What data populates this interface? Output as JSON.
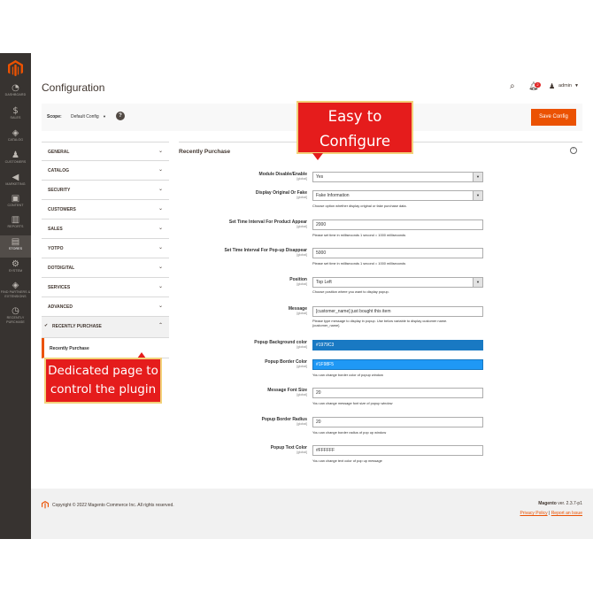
{
  "sidebar": {
    "items": [
      {
        "label": "DASHBOARD",
        "icon": "dashboard-icon"
      },
      {
        "label": "SALES",
        "icon": "dollar-icon"
      },
      {
        "label": "CATALOG",
        "icon": "cube-icon"
      },
      {
        "label": "CUSTOMERS",
        "icon": "person-icon"
      },
      {
        "label": "MARKETING",
        "icon": "megaphone-icon"
      },
      {
        "label": "CONTENT",
        "icon": "content-icon"
      },
      {
        "label": "REPORTS",
        "icon": "bar-chart-icon"
      },
      {
        "label": "STORES",
        "icon": "store-icon"
      },
      {
        "label": "SYSTEM",
        "icon": "gear-icon"
      },
      {
        "label": "FIND PARTNERS & EXTENSIONS",
        "icon": "cubes-icon"
      },
      {
        "label": "RECENTLY PURCHASE",
        "icon": "clock-icon"
      }
    ],
    "active": "STORES"
  },
  "header": {
    "title": "Configuration",
    "notification_count": "2",
    "user": "admin"
  },
  "scope": {
    "label": "Scope:",
    "value": "Default Config",
    "save_label": "Save Config"
  },
  "tabs": [
    {
      "label": "GENERAL"
    },
    {
      "label": "CATALOG"
    },
    {
      "label": "SECURITY"
    },
    {
      "label": "CUSTOMERS"
    },
    {
      "label": "SALES"
    },
    {
      "label": "YOTPO"
    },
    {
      "label": "DOTDIGITAL"
    },
    {
      "label": "SERVICES"
    },
    {
      "label": "ADVANCED"
    },
    {
      "label": "RECENTLY PURCHASE"
    }
  ],
  "subtab": {
    "label": "Recently Purchase"
  },
  "section": {
    "title": "Recently Purchase"
  },
  "fields": {
    "module": {
      "label": "Module Disable/Enable",
      "scope": "[global]",
      "value": "Yes"
    },
    "display": {
      "label": "Display Original Or Fake",
      "scope": "[global]",
      "value": "Fake Information",
      "note": "Choose option whether display original or fake purchase data."
    },
    "interval_appear": {
      "label": "Set Time Interval For Product Appear",
      "scope": "[global]",
      "value": "2000",
      "note": "Please set time in milliseconds 1 second = 1000 milliseconds"
    },
    "interval_disappear": {
      "label": "Set Time Interval For Pop-up Disappear",
      "scope": "[global]",
      "value": "5000",
      "note": "Please set time in milliseconds 1 second = 1000 milliseconds"
    },
    "position": {
      "label": "Position",
      "scope": "[global]",
      "value": "Top Left",
      "note": "Choose position where you want to display popup."
    },
    "message": {
      "label": "Message",
      "scope": "[global]",
      "value": "[customer_name] just bought this item",
      "note": "Please type message to display in popup. Use below variable to display customer name.{customer_name}"
    },
    "bg_color": {
      "label": "Popup Background color",
      "scope": "[global]",
      "value": "#1979C3",
      "color": "#1979c3"
    },
    "border_color": {
      "label": "Popup Border Color",
      "scope": "[global]",
      "value": "#1F98F5",
      "color": "#1f98f5",
      "note": "You can change border color of popup window"
    },
    "font_size": {
      "label": "Message Font Size",
      "scope": "[global]",
      "value": "20",
      "note": "You can change message font size of popup window"
    },
    "border_radius": {
      "label": "Popup Border Radius",
      "scope": "[global]",
      "value": "20",
      "note": "You can change border radius of pop up window"
    },
    "text_color": {
      "label": "Popup Text Color",
      "scope": "[global]",
      "value": "#FFFFFF",
      "note": "You can change text color of pop up message"
    }
  },
  "footer": {
    "copyright": "Copyright © 2022 Magento Commerce Inc. All rights reserved.",
    "brand": "Magento",
    "version": "ver. 2.3.7-p1",
    "privacy": "Privacy Policy",
    "separator": "|",
    "report": "Report an Issue"
  },
  "callouts": {
    "easy_line1": "Easy to",
    "easy_line2": "Configure",
    "dedicated_line1": "Dedicated page to",
    "dedicated_line2": "control the plugin"
  },
  "colors": {
    "accent": "#eb5202",
    "sidebar": "#373330",
    "callout": "#e51c1c"
  }
}
